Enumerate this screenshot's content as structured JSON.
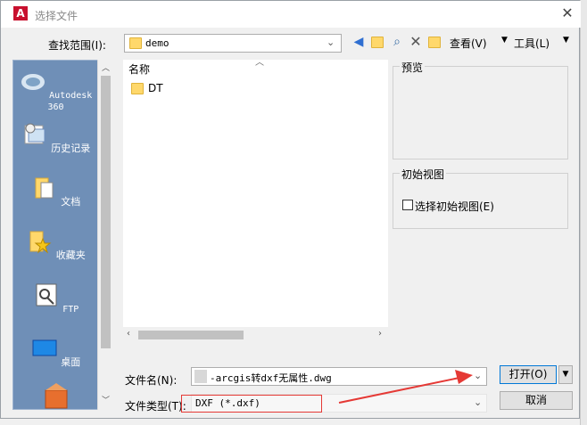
{
  "window": {
    "title": "选择文件",
    "app_icon": "A"
  },
  "lookin": {
    "label": "查找范围(I):",
    "value": "demo"
  },
  "toolbar": {
    "view_label": "查看(V)",
    "tools_label": "工具(L)"
  },
  "sidebar": {
    "items": [
      {
        "label": "Autodesk 360",
        "icon": "cloud-icon"
      },
      {
        "label": "历史记录",
        "icon": "history-icon"
      },
      {
        "label": "文档",
        "icon": "documents-icon"
      },
      {
        "label": "收藏夹",
        "icon": "favorites-icon"
      },
      {
        "label": "FTP",
        "icon": "ftp-icon"
      },
      {
        "label": "桌面",
        "icon": "desktop-icon"
      }
    ]
  },
  "file_list": {
    "column_header": "名称",
    "items": [
      {
        "name": "DT",
        "type": "folder"
      }
    ]
  },
  "preview": {
    "label": "预览"
  },
  "initial_view": {
    "label": "初始视图",
    "checkbox_label": "选择初始视图(E)",
    "checked": false
  },
  "filename": {
    "label": "文件名(N):",
    "value": "-arcgis转dxf无属性.dwg"
  },
  "filetype": {
    "label": "文件类型(T):",
    "value": "DXF (*.dxf)"
  },
  "buttons": {
    "open": "打开(O)",
    "cancel": "取消"
  },
  "colors": {
    "annotation_red": "#e53935",
    "sidebar_bg": "#6f8fb7"
  }
}
